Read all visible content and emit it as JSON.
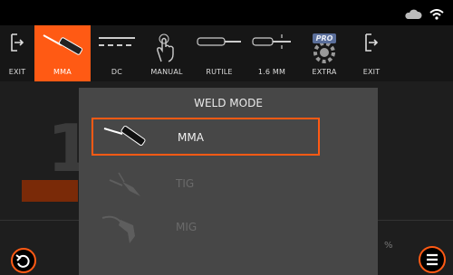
{
  "colors": {
    "accent": "#ff5a14",
    "background": "#1e1e1e",
    "overlay": "#474747"
  },
  "status": {
    "icons": [
      "cloud-icon",
      "wifi-icon"
    ]
  },
  "toolbar": {
    "exit_left": "EXIT",
    "mma": "MMA",
    "dc": "DC",
    "manual": "MANUAL",
    "rutile": "RUTILE",
    "size": "1.6 MM",
    "extra": "EXTRA",
    "exit_right": "EXIT",
    "extra_badge": "PRO"
  },
  "background": {
    "digit": "1",
    "percent": "%"
  },
  "dialog": {
    "title": "WELD MODE",
    "modes": [
      {
        "label": "MMA",
        "selected": true,
        "enabled": true
      },
      {
        "label": "TIG",
        "selected": false,
        "enabled": false
      },
      {
        "label": "MIG",
        "selected": false,
        "enabled": false
      }
    ]
  }
}
